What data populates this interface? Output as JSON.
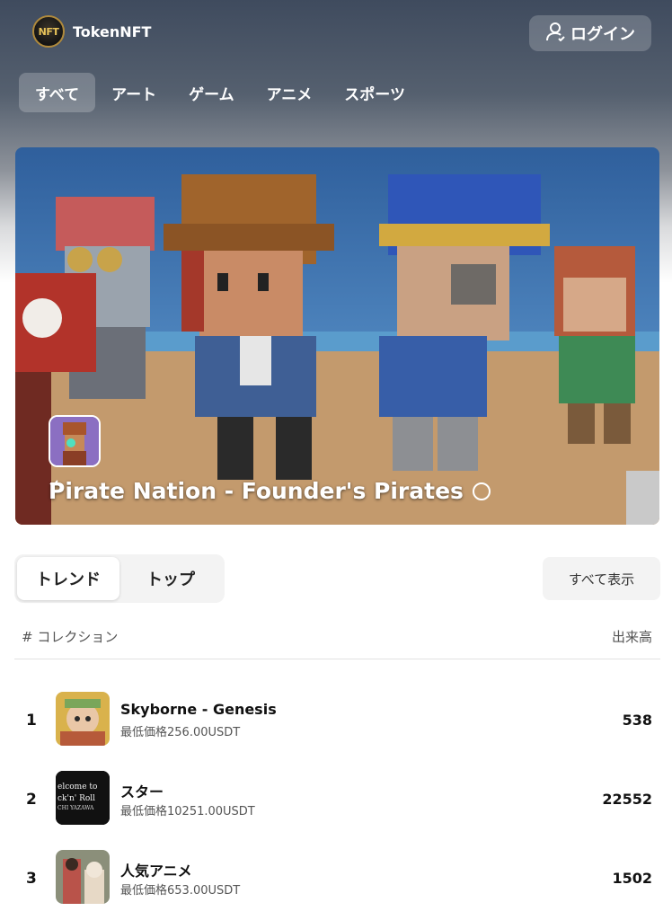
{
  "brand": {
    "name": "TokenNFT",
    "logo_text": "NFT"
  },
  "header": {
    "login_label": "ログイン",
    "login_icon": "user-icon"
  },
  "categories": [
    {
      "label": "すべて",
      "active": true
    },
    {
      "label": "アート",
      "active": false
    },
    {
      "label": "ゲーム",
      "active": false
    },
    {
      "label": "アニメ",
      "active": false
    },
    {
      "label": "スポーツ",
      "active": false
    }
  ],
  "hero": {
    "title": "Pirate Nation - Founder's Pirates",
    "verified_icon": "check-circle-icon"
  },
  "tabs": {
    "trend": "トレンド",
    "top": "トップ"
  },
  "view_all_label": "すべて表示",
  "table": {
    "col_collection": "# コレクション",
    "col_volume": "出来高",
    "rows": [
      {
        "rank": "1",
        "name": "Skyborne - Genesis",
        "price": "最低価格256.00USDT",
        "volume": "538"
      },
      {
        "rank": "2",
        "name": "スター",
        "price": "最低価格10251.00USDT",
        "volume": "22552",
        "thumb_text_1": "elcome to",
        "thumb_text_2": "ck'n' Roll",
        "thumb_text_3": "CHI YAZAWA"
      },
      {
        "rank": "3",
        "name": "人気アニメ",
        "price": "最低価格653.00USDT",
        "volume": "1502"
      }
    ]
  },
  "colors": {
    "accent": "#e8c35a",
    "text": "#111111",
    "muted": "#555555"
  }
}
